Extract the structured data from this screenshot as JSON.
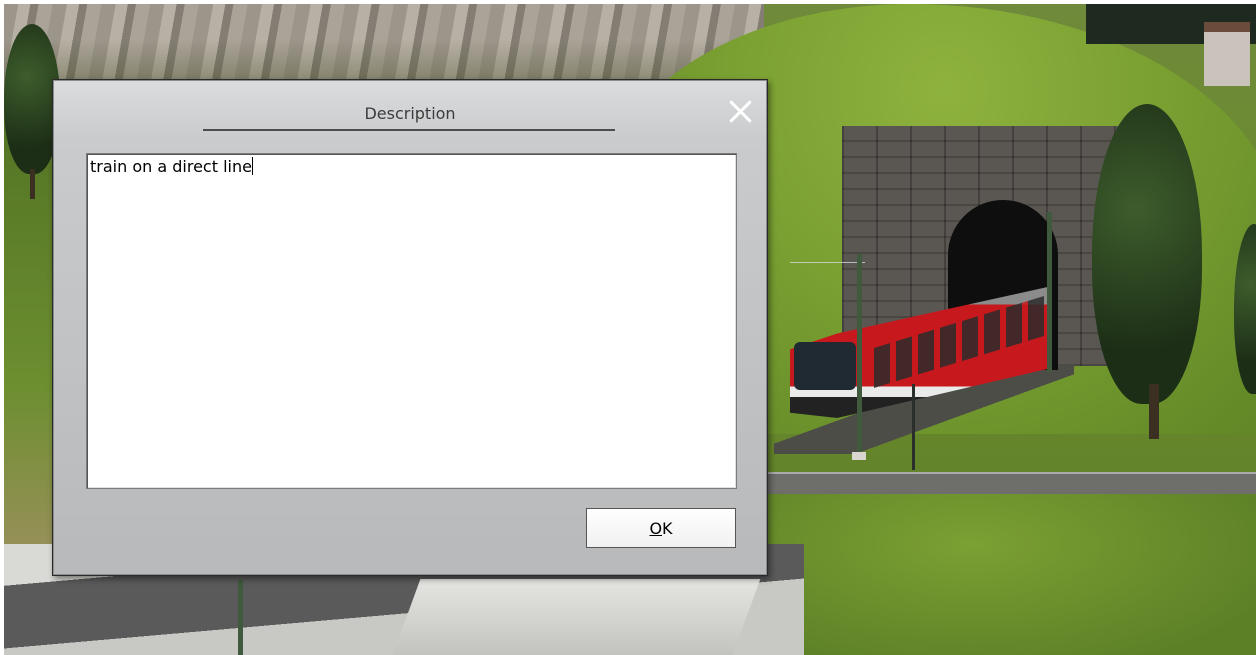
{
  "dialog": {
    "title": "Description",
    "description_text": "train on a direct line",
    "ok_button": {
      "accelerator": "O",
      "rest": "K"
    },
    "close_icon": "close-icon"
  }
}
